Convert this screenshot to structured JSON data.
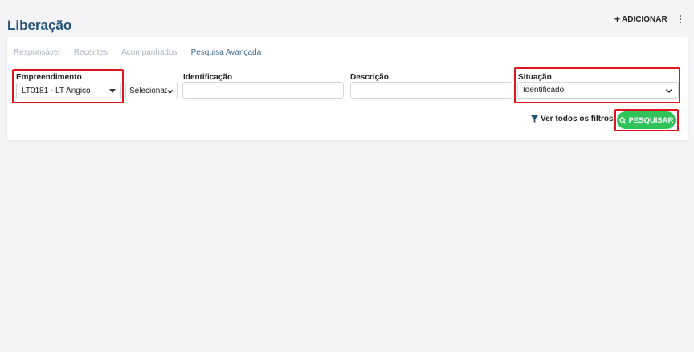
{
  "page": {
    "title": "Liberação"
  },
  "header": {
    "add_label": "ADICIONAR",
    "add_icon": "plus-icon",
    "more_icon": "kebab-menu-icon"
  },
  "tabs": [
    {
      "label": "Responsável",
      "active": false
    },
    {
      "label": "Recentes",
      "active": false
    },
    {
      "label": "Acompanhados",
      "active": false
    },
    {
      "label": "Pesquisa Avançada",
      "active": true
    }
  ],
  "filters": {
    "empreendimento": {
      "label": "Empreendimento",
      "value": "LT0181 - LT Angico"
    },
    "selecionado": {
      "value": "Selecionado"
    },
    "identificacao": {
      "label": "Identificação",
      "value": ""
    },
    "descricao": {
      "label": "Descrição",
      "value": ""
    },
    "situacao": {
      "label": "Situação",
      "value": "Identificado"
    }
  },
  "actions": {
    "all_filters_label": "Ver todos os filtros",
    "all_filters_icon": "filter-icon",
    "search_label": "PESQUISAR",
    "search_icon": "search-icon"
  },
  "colors": {
    "title": "#23527c",
    "tab_active": "#3d6b92",
    "tab_inactive": "#a9b3bd",
    "search_button": "#2ec45a",
    "highlight": "#e0151b"
  }
}
